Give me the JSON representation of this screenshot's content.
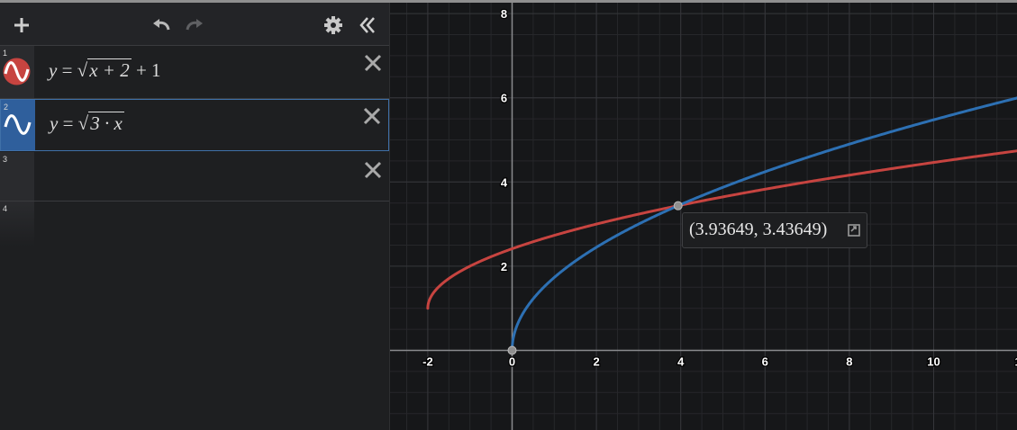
{
  "colors": {
    "red": "#c74440",
    "blue": "#2d70b3",
    "accent": "#3f70a8"
  },
  "toolbar": {
    "icons": [
      "plus-icon",
      "undo-icon",
      "redo-icon",
      "gear-icon",
      "collapse-icon"
    ]
  },
  "expressions": [
    {
      "num": "1",
      "lhs": "y",
      "op": "=",
      "radicand": "x + 2",
      "tail": "+ 1",
      "color": "#c74440",
      "icon": "sine-wave-icon"
    },
    {
      "num": "2",
      "lhs": "y",
      "op": "=",
      "radicand": "3 · x",
      "tail": "",
      "color": "#2d70b3",
      "icon": "sine-wave-icon"
    },
    {
      "num": "3"
    },
    {
      "num": "4"
    }
  ],
  "graph": {
    "x_ticks": [
      "-2",
      "0",
      "2",
      "4",
      "6",
      "8",
      "10",
      "1"
    ],
    "y_ticks": [
      "8",
      "6",
      "4",
      "2"
    ],
    "xlim": [
      -2.9,
      12.1
    ],
    "ylim": [
      -1.9,
      8.2
    ],
    "intersection": {
      "x": 3.93649,
      "y": 3.43649
    },
    "tooltip": "(3.93649, 3.43649)",
    "points_marked": [
      {
        "x": 0,
        "y": 0
      },
      {
        "x": 3.93649,
        "y": 3.43649
      }
    ]
  }
}
